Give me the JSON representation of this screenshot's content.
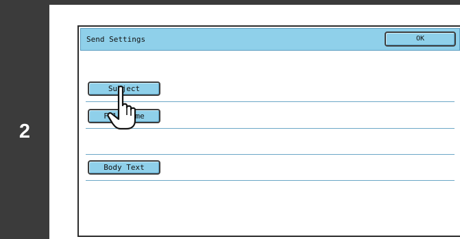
{
  "step": {
    "number": "2"
  },
  "dialog": {
    "title": "Send Settings",
    "ok_label": "OK"
  },
  "buttons": {
    "subject": "Subject",
    "file_name": "File Name",
    "body_text": "Body Text"
  },
  "colors": {
    "button_fill": "#8fd0ea",
    "step_bar": "#3b3b3b",
    "divider": "#6aa6c6"
  },
  "icons": {
    "pointer": "hand-pointer-icon"
  }
}
